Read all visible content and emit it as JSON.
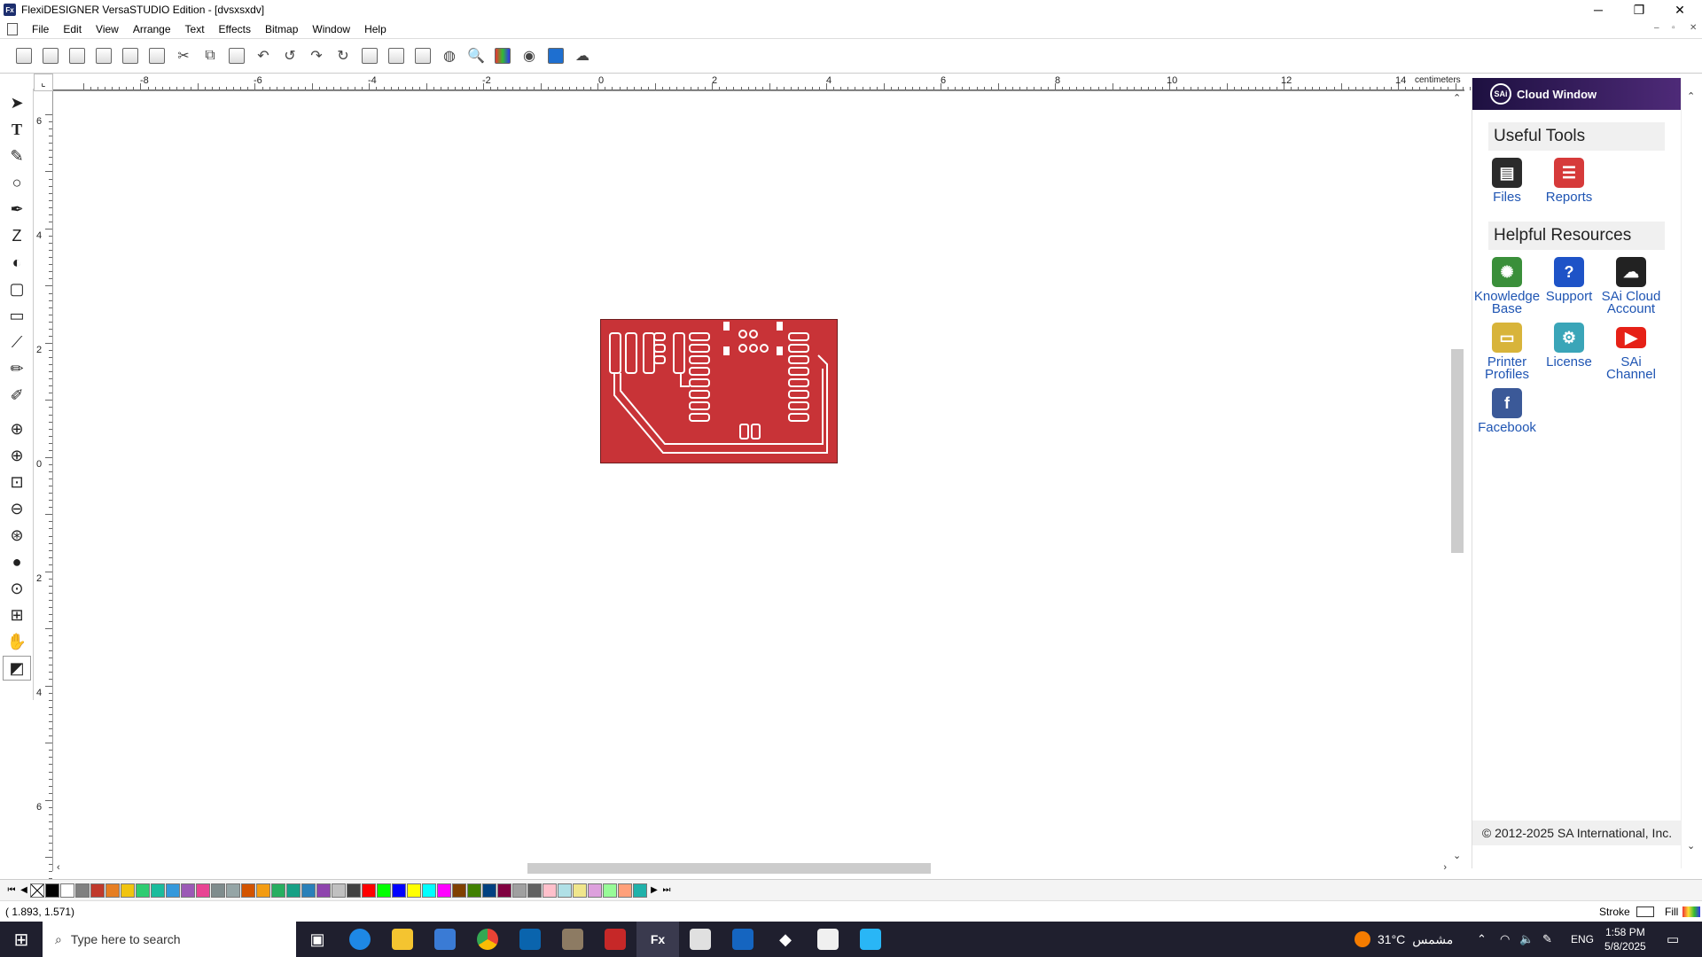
{
  "window": {
    "title": "FlexiDESIGNER VersaSTUDIO Edition - [dvsxsxdv]",
    "app_icon_text": "Fx",
    "controls": {
      "minimize": "─",
      "restore": "❐",
      "close": "✕"
    }
  },
  "menu": {
    "items": [
      "File",
      "Edit",
      "View",
      "Arrange",
      "Text",
      "Effects",
      "Bitmap",
      "Window",
      "Help"
    ]
  },
  "ruler": {
    "unit": "centimeters",
    "top_labels": [
      "-8",
      "-6",
      "-4",
      "-2",
      "0",
      "2",
      "4",
      "6",
      "8",
      "10",
      "12",
      "14"
    ],
    "left_labels": [
      "6",
      "4",
      "2",
      "0",
      "2",
      "4",
      "6"
    ]
  },
  "cloud_window": {
    "header_logo": "SAi",
    "header_title": "Cloud Window",
    "useful_tools_title": "Useful Tools",
    "useful_tools": [
      {
        "label": "Files",
        "icon": "files-icon",
        "color": "#2b2b2b"
      },
      {
        "label": "Reports",
        "icon": "reports-icon",
        "color": "#d63a3a"
      }
    ],
    "helpful_resources_title": "Helpful Resources",
    "helpful_resources": [
      {
        "label": "Knowledge Base",
        "icon": "knowledge-base-icon",
        "color": "#3a8f3a"
      },
      {
        "label": "Support",
        "icon": "support-icon",
        "color": "#1e53c7"
      },
      {
        "label": "SAi Cloud Account",
        "icon": "cloud-account-icon",
        "color": "#222222"
      },
      {
        "label": "Printer Profiles",
        "icon": "printer-profiles-icon",
        "color": "#d8b43a"
      },
      {
        "label": "License",
        "icon": "license-icon",
        "color": "#3aa5b8"
      },
      {
        "label": "SAi Channel",
        "icon": "youtube-icon",
        "color": "#e62117"
      },
      {
        "label": "Facebook",
        "icon": "facebook-icon",
        "color": "#3b5998"
      }
    ],
    "copyright": "© 2012-2025 SA International, Inc."
  },
  "status": {
    "coords": "(   1.893,      1.571)",
    "stroke_label": "Stroke",
    "fill_label": "Fill"
  },
  "taskbar": {
    "search_placeholder": "Type here to search",
    "weather": "31°C",
    "weather_text": "مشمس",
    "language": "ENG",
    "time": "1:58 PM",
    "date": "5/8/2025"
  },
  "palette_colors": [
    "#000000",
    "#ffffff",
    "#808080",
    "#c0392b",
    "#e67e22",
    "#f1c40f",
    "#2ecc71",
    "#1abc9c",
    "#3498db",
    "#9b59b6",
    "#e84393",
    "#7f8c8d",
    "#95a5a6",
    "#d35400",
    "#f39c12",
    "#27ae60",
    "#16a085",
    "#2980b9",
    "#8e44ad",
    "#c0c0c0",
    "#404040",
    "#ff0000",
    "#00ff00",
    "#0000ff",
    "#ffff00",
    "#00ffff",
    "#ff00ff",
    "#804000",
    "#408000",
    "#004080",
    "#800040",
    "#a0a0a0",
    "#606060",
    "#ffc0cb",
    "#b0e0e6",
    "#f0e68c",
    "#dda0dd",
    "#98fb98",
    "#ffa07a",
    "#20b2aa"
  ]
}
